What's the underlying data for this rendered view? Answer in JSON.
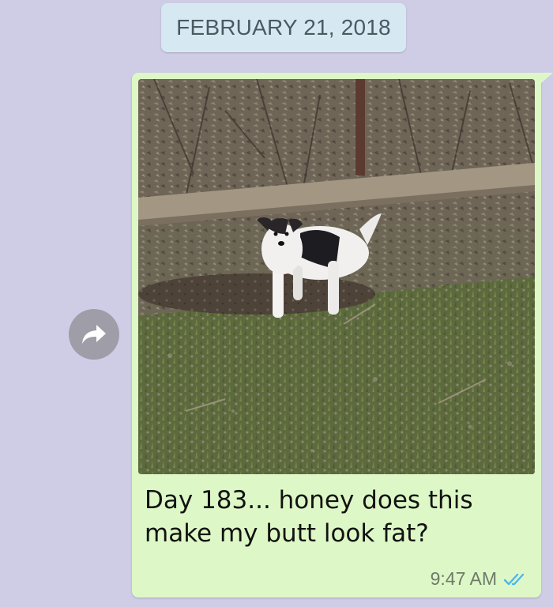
{
  "conversation": {
    "date_separator": "FEBRUARY 21, 2018"
  },
  "message": {
    "caption_line1": "Day 183... honey does this",
    "caption_line2": "make my butt look fat?",
    "timestamp": "9:47 AM",
    "status_icon": "read-double-check-icon",
    "photo_subject": "dog-in-yard-photo"
  },
  "controls": {
    "forward_icon": "forward-arrow-icon"
  },
  "colors": {
    "background": "#cfcde6",
    "bubble": "#ddf8c6",
    "date_pill": "#d6e9f2",
    "check_blue": "#4fb6ec"
  }
}
